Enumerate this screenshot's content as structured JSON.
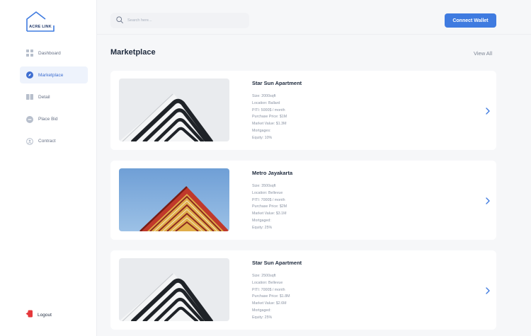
{
  "brand": {
    "name": "ACRE LINK"
  },
  "sidebar": {
    "items": [
      {
        "label": "Dashboard",
        "icon": "grid-icon"
      },
      {
        "label": "Marketplace",
        "icon": "compass-icon",
        "active": true
      },
      {
        "label": "Detail",
        "icon": "book-icon"
      },
      {
        "label": "Place Bid",
        "icon": "chat-icon"
      },
      {
        "label": "Contract",
        "icon": "user-circle-icon"
      }
    ],
    "logout": {
      "label": "Logout",
      "icon": "logout-icon"
    }
  },
  "header": {
    "search_placeholder": "Search here...",
    "connect_label": "Connect Wallet"
  },
  "main": {
    "title": "Marketplace",
    "view_all": "View All",
    "listings": [
      {
        "name": "Star Sun Apartment",
        "size": "Size: 2000sqft",
        "location": "Location: Ballard",
        "piti": "PITI: 5000$ / month",
        "purchase": "Purchase Price: $1M",
        "market": "Market Value: $1.3M",
        "mortgages": "Mortgages:",
        "equity": "Equity: 10%"
      },
      {
        "name": "Metro Jayakarta",
        "size": "Size: 3500sqft",
        "location": "Location: Bellevue",
        "piti": "PITI: 7000$ / month",
        "purchase": "Purchase Price: $2M",
        "market": "Market Value: $3.1M",
        "mortgages": "Mortgaged:",
        "equity": "Equity: 25%"
      },
      {
        "name": "Star Sun Apartment",
        "size": "Size: 2500sqft",
        "location": "Location: Bellevue",
        "piti": "PITI: 7000$ / month",
        "purchase": "Purchase Price: $1.8M",
        "market": "Market Value: $2.6M",
        "mortgages": "Mortgaged:",
        "equity": "Equity: 25%"
      }
    ]
  },
  "colors": {
    "accent": "#3f7be0",
    "active_bg": "#eef3fc",
    "logout_red": "#e5383b",
    "brand_navy": "#233a6b"
  }
}
